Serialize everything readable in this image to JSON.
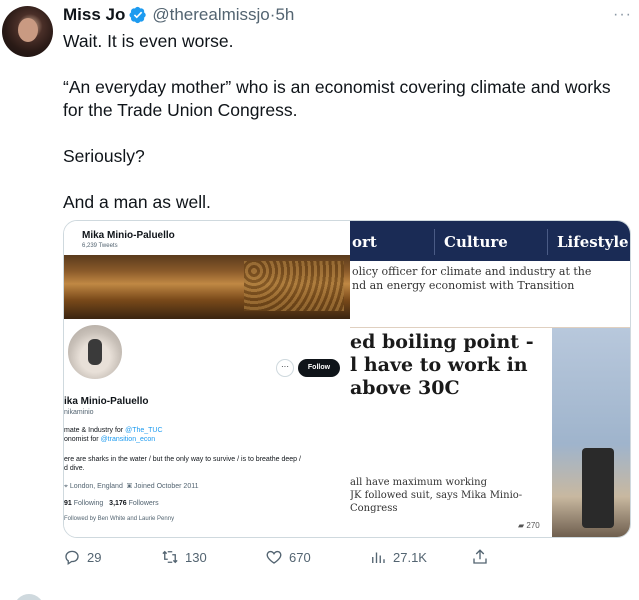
{
  "tweet": {
    "name": "Miss Jo",
    "handle": "@therealmissjo",
    "separator": "·",
    "time": "5h",
    "more": "···",
    "paragraphs": [
      "Wait. It is even worse.",
      "“An everyday mother” who is an economist covering climate and works for the Trade Union Congress.",
      "Seriously?",
      "And a man as well."
    ]
  },
  "media": {
    "profile": {
      "header_name": "Mika Minio-Paluello",
      "tweet_count": "6,239 Tweets",
      "more_button": "···",
      "follow_button": "Follow",
      "display_name": "ika Minio-Paluello",
      "handle": "nikaminio",
      "bio_line1_prefix": "mate & Industry for ",
      "bio_line1_link": "@The_TUC",
      "bio_line2_prefix": "onomist for ",
      "bio_line2_link": "@transition_econ",
      "bio_line3": "ere are sharks in the water / but the only way to survive / is to breathe deep /",
      "bio_line4": "d dive.",
      "location": "London, England",
      "joined": "Joined October 2011",
      "following_count": "91",
      "following_label": "Following",
      "followers_count": "3,176",
      "followers_label": "Followers",
      "followed_by": "Followed by Ben White and Laurie Penny"
    },
    "article": {
      "nav": [
        "ort",
        "Culture",
        "Lifestyle"
      ],
      "subtitle_line1": "olicy officer for climate and industry at the",
      "subtitle_line2": "nd an energy economist with Transition",
      "headline": "ed boiling point - l have to work in above 30C",
      "headline_lines": [
        "ed boiling point -",
        "l have to work in",
        "above 30C"
      ],
      "body_lines": [
        "all have maximum working",
        "JK followed suit, says Mika Minio-",
        "Congress"
      ],
      "comments": "270"
    }
  },
  "actions": {
    "replies": "29",
    "retweets": "130",
    "likes": "670",
    "views": "27.1K"
  },
  "colors": {
    "link": "#1d9bf0",
    "verified": "#1d9bf0",
    "nav_bg": "#1a2b55",
    "muted": "#536471"
  }
}
